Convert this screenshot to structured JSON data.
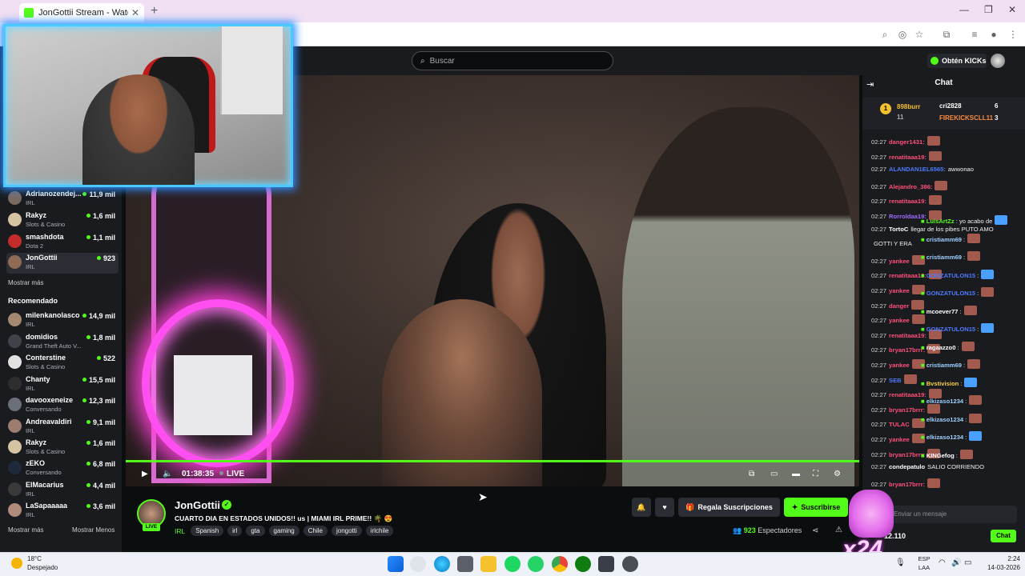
{
  "browser": {
    "tab_title": "JonGottii Stream - Watch Live o",
    "tab_close": "✕",
    "new_tab": "+",
    "window_controls": [
      "—",
      "❐",
      "✕"
    ]
  },
  "header": {
    "search_placeholder": "Buscar",
    "get_kicks": "Obtén KICKs"
  },
  "sidebar": {
    "following": [
      {
        "name": "Adrianozendej...",
        "category": "IRL",
        "viewers": "11,9 mil",
        "color": "#7a6a62"
      },
      {
        "name": "Rakyz",
        "category": "Slots & Casino",
        "viewers": "1,6 mil",
        "color": "#d6c3a4"
      },
      {
        "name": "smashdota",
        "category": "Dota 2",
        "viewers": "1,1 mil",
        "color": "#c42b2b"
      },
      {
        "name": "JonGottii",
        "category": "IRL",
        "viewers": "923",
        "color": "#8f6a55"
      }
    ],
    "show_more_1": "Mostrar más",
    "recommended_heading": "Recomendado",
    "recommended": [
      {
        "name": "milenkanolasco",
        "category": "IRL",
        "viewers": "14,9 mil",
        "color": "#a58870"
      },
      {
        "name": "domidios",
        "category": "Grand Theft Auto V...",
        "viewers": "1,8 mil",
        "color": "#40424a"
      },
      {
        "name": "Conterstine",
        "category": "Slots & Casino",
        "viewers": "522",
        "color": "#e2e2e2"
      },
      {
        "name": "Chanty",
        "category": "IRL",
        "viewers": "15,5 mil",
        "color": "#2e2e2e"
      },
      {
        "name": "davooxeneize",
        "category": "Conversando",
        "viewers": "12,3 mil",
        "color": "#6b6f78"
      },
      {
        "name": "Andreavaldiri",
        "category": "IRL",
        "viewers": "9,1 mil",
        "color": "#9c7d70"
      },
      {
        "name": "Rakyz",
        "category": "Slots & Casino",
        "viewers": "1,6 mil",
        "color": "#d6c3a4"
      },
      {
        "name": "zEKO",
        "category": "Conversando",
        "viewers": "6,8 mil",
        "color": "#1e2a3a"
      },
      {
        "name": "ElMacarius",
        "category": "IRL",
        "viewers": "4,4 mil",
        "color": "#3a3a3a"
      },
      {
        "name": "LaSapaaaaa",
        "category": "IRL",
        "viewers": "3,6 mil",
        "color": "#b08a7a"
      }
    ],
    "show_more_2": "Mostrar más",
    "show_less": "Mostrar Menos"
  },
  "player": {
    "time": "01:38:35",
    "live": "LIVE"
  },
  "stream": {
    "live_tag": "LIVE",
    "streamer": "JonGottii",
    "title": "CUARTO DIA EN ESTADOS UNIDOS!! us | MIAMI IRL PRIME!! 🌴 😍",
    "category": "IRL",
    "tags": [
      "Spanish",
      "irl",
      "gta",
      "gaming",
      "Chile",
      "jongotti",
      "irlchile"
    ],
    "gift_subs": "Regala Suscripciones",
    "subscribe": "Suscribirse",
    "viewers_count": "923",
    "viewers_label": "Espectadores"
  },
  "chat": {
    "title": "Chat",
    "pinned": {
      "top_gifter": "898burr",
      "top_gifter_count": "11",
      "gifter_2": "cri2828",
      "gifter_2_count": "6",
      "gifter_3": "FIREKICKSCLL11",
      "gifter_3_count": "3"
    },
    "messages": [
      {
        "time": "02:27",
        "user": "danger1431:",
        "color": "#ff4f7a",
        "text": ""
      },
      {
        "time": "02:27",
        "user": "renatitaaa19:",
        "color": "#ff4f7a",
        "text": ""
      },
      {
        "time": "02:27",
        "user": "ALANDAN1EL6565:",
        "color": "#4f7aff",
        "text": "awwonao"
      },
      {
        "time": "02:27",
        "user": "Alejandro_386:",
        "color": "#ff4f7a",
        "text": ""
      },
      {
        "time": "02:27",
        "user": "renatitaaa19:",
        "color": "#ff4f7a",
        "text": ""
      },
      {
        "time": "02:27",
        "user": "Rorroldaa19:",
        "color": "#a06bff",
        "text": ""
      },
      {
        "time": "02:27",
        "user": "TortoC",
        "color": "#ffffff",
        "text": "llegar de los pibes PUTO AMO"
      },
      {
        "time": "",
        "user": "",
        "color": "#ffffff",
        "text": "GOTTI Y ERA"
      },
      {
        "time": "02:27",
        "user": "yankee",
        "color": "#ff4f7a",
        "text": ""
      },
      {
        "time": "02:27",
        "user": "renatitaaa19:",
        "color": "#ff4f7a",
        "text": ""
      },
      {
        "time": "02:27",
        "user": "yankee",
        "color": "#ff4f7a",
        "text": ""
      },
      {
        "time": "02:27",
        "user": "danger",
        "color": "#ff4f7a",
        "text": ""
      },
      {
        "time": "02:27",
        "user": "yankee",
        "color": "#ff4f7a",
        "text": ""
      },
      {
        "time": "02:27",
        "user": "renatitaaa19:",
        "color": "#ff4f7a",
        "text": ""
      },
      {
        "time": "02:27",
        "user": "bryan17brrr:",
        "color": "#ff4f7a",
        "text": ""
      },
      {
        "time": "02:27",
        "user": "yankee",
        "color": "#ff4f7a",
        "text": ""
      },
      {
        "time": "02:27",
        "user": "SEB",
        "color": "#4f7aff",
        "text": ""
      },
      {
        "time": "02:27",
        "user": "renatitaaa19:",
        "color": "#ff4f7a",
        "text": ""
      },
      {
        "time": "02:27",
        "user": "bryan17brrr:",
        "color": "#ff4f7a",
        "text": ""
      },
      {
        "time": "02:27",
        "user": "TULAC",
        "color": "#ff4f7a",
        "text": ""
      },
      {
        "time": "02:27",
        "user": "yankee",
        "color": "#ff4f7a",
        "text": ""
      },
      {
        "time": "02:27",
        "user": "bryan17brrr:",
        "color": "#ff4f7a",
        "text": ""
      },
      {
        "time": "02:27",
        "user": "condepatulo",
        "color": "#ffffff",
        "text": "SALIO CORRIENDO"
      },
      {
        "time": "02:27",
        "user": "bryan17brrr:",
        "color": "#ff4f7a",
        "text": ""
      }
    ],
    "overlay": [
      {
        "user": "LuisArtZz",
        "text": ": yo acabo de",
        "color": "#53fc18"
      },
      {
        "user": "cristiamm69",
        "text": ":",
        "color": "#9fd0ff"
      },
      {
        "user": "cristiamm69",
        "text": ":",
        "color": "#9fd0ff"
      },
      {
        "user": "GONZATULON15",
        "text": ":",
        "color": "#4f7aff"
      },
      {
        "user": "GONZATULON15",
        "text": ":",
        "color": "#4f7aff"
      },
      {
        "user": "mcoever77",
        "text": ":",
        "color": "#ffffff"
      },
      {
        "user": "GONZATULON15",
        "text": ":",
        "color": "#4f7aff"
      },
      {
        "user": "ragaazzo0",
        "text": ":",
        "color": "#ffffff"
      },
      {
        "user": "cristiamm69",
        "text": ":",
        "color": "#9fd0ff"
      },
      {
        "user": "Bvstivision",
        "text": ":",
        "color": "#f5d142"
      },
      {
        "user": "elkizaso1234",
        "text": ":",
        "color": "#9fd0ff"
      },
      {
        "user": "elkizaso1234",
        "text": ":",
        "color": "#9fd0ff"
      },
      {
        "user": "elkizaso1234",
        "text": ":",
        "color": "#9fd0ff"
      },
      {
        "user": "KINGefog",
        "text": ":",
        "color": "#ffffff"
      }
    ],
    "input_placeholder": "Enviar un mensaje",
    "points": "12.110",
    "send": "Chat"
  },
  "overlay_badge": "x24",
  "taskbar": {
    "temperature": "18°C",
    "weather": "Despejado",
    "lang_1": "ESP",
    "lang_2": "LAA",
    "time": "2:24",
    "date": "14-03-2026"
  }
}
